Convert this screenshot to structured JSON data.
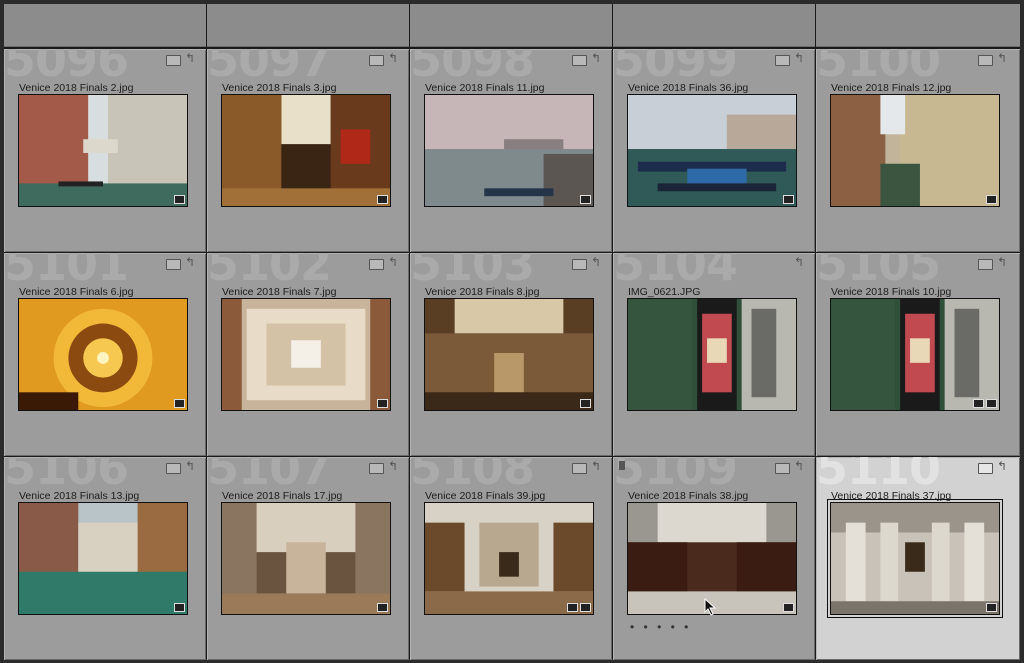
{
  "grid": {
    "cells": [
      {
        "index": "5096",
        "filename": "Venice 2018 Finals 2.jpg",
        "thumb": "bridge-of-sighs",
        "badges": 1
      },
      {
        "index": "5097",
        "filename": "Venice 2018 Finals 3.jpg",
        "thumb": "palazzo-interior",
        "badges": 1
      },
      {
        "index": "5098",
        "filename": "Venice 2018 Finals 11.jpg",
        "thumb": "lagoon-boats",
        "badges": 1
      },
      {
        "index": "5099",
        "filename": "Venice 2018 Finals 36.jpg",
        "thumb": "gondolas",
        "badges": 1
      },
      {
        "index": "5100",
        "filename": "Venice 2018 Finals 12.jpg",
        "thumb": "narrow-canal",
        "badges": 1
      },
      {
        "index": "5101",
        "filename": "Venice 2018 Finals 6.jpg",
        "thumb": "spiral-stair",
        "badges": 1
      },
      {
        "index": "5102",
        "filename": "Venice 2018 Finals 7.jpg",
        "thumb": "ceiling",
        "badges": 1
      },
      {
        "index": "5103",
        "filename": "Venice 2018 Finals 8.jpg",
        "thumb": "grand-hall",
        "badges": 1
      },
      {
        "index": "5104",
        "filename": "IMG_0621.JPG",
        "thumb": "gondola-top",
        "badges": 0
      },
      {
        "index": "5105",
        "filename": "Venice 2018 Finals 10.jpg",
        "thumb": "gondola-top",
        "badges": 2
      },
      {
        "index": "5106",
        "filename": "Venice 2018 Finals 13.jpg",
        "thumb": "green-canal",
        "badges": 1
      },
      {
        "index": "5107",
        "filename": "Venice 2018 Finals 17.jpg",
        "thumb": "church-nave",
        "badges": 1
      },
      {
        "index": "5108",
        "filename": "Venice 2018 Finals 39.jpg",
        "thumb": "altar",
        "badges": 2
      },
      {
        "index": "5109",
        "filename": "Venice 2018 Finals 38.jpg",
        "thumb": "choir",
        "badges": 1,
        "flag": true,
        "dots": "• • • • •"
      },
      {
        "index": "5110",
        "filename": "Venice 2018 Finals 37.jpg",
        "thumb": "columns",
        "badges": 1,
        "selected": true
      }
    ]
  }
}
